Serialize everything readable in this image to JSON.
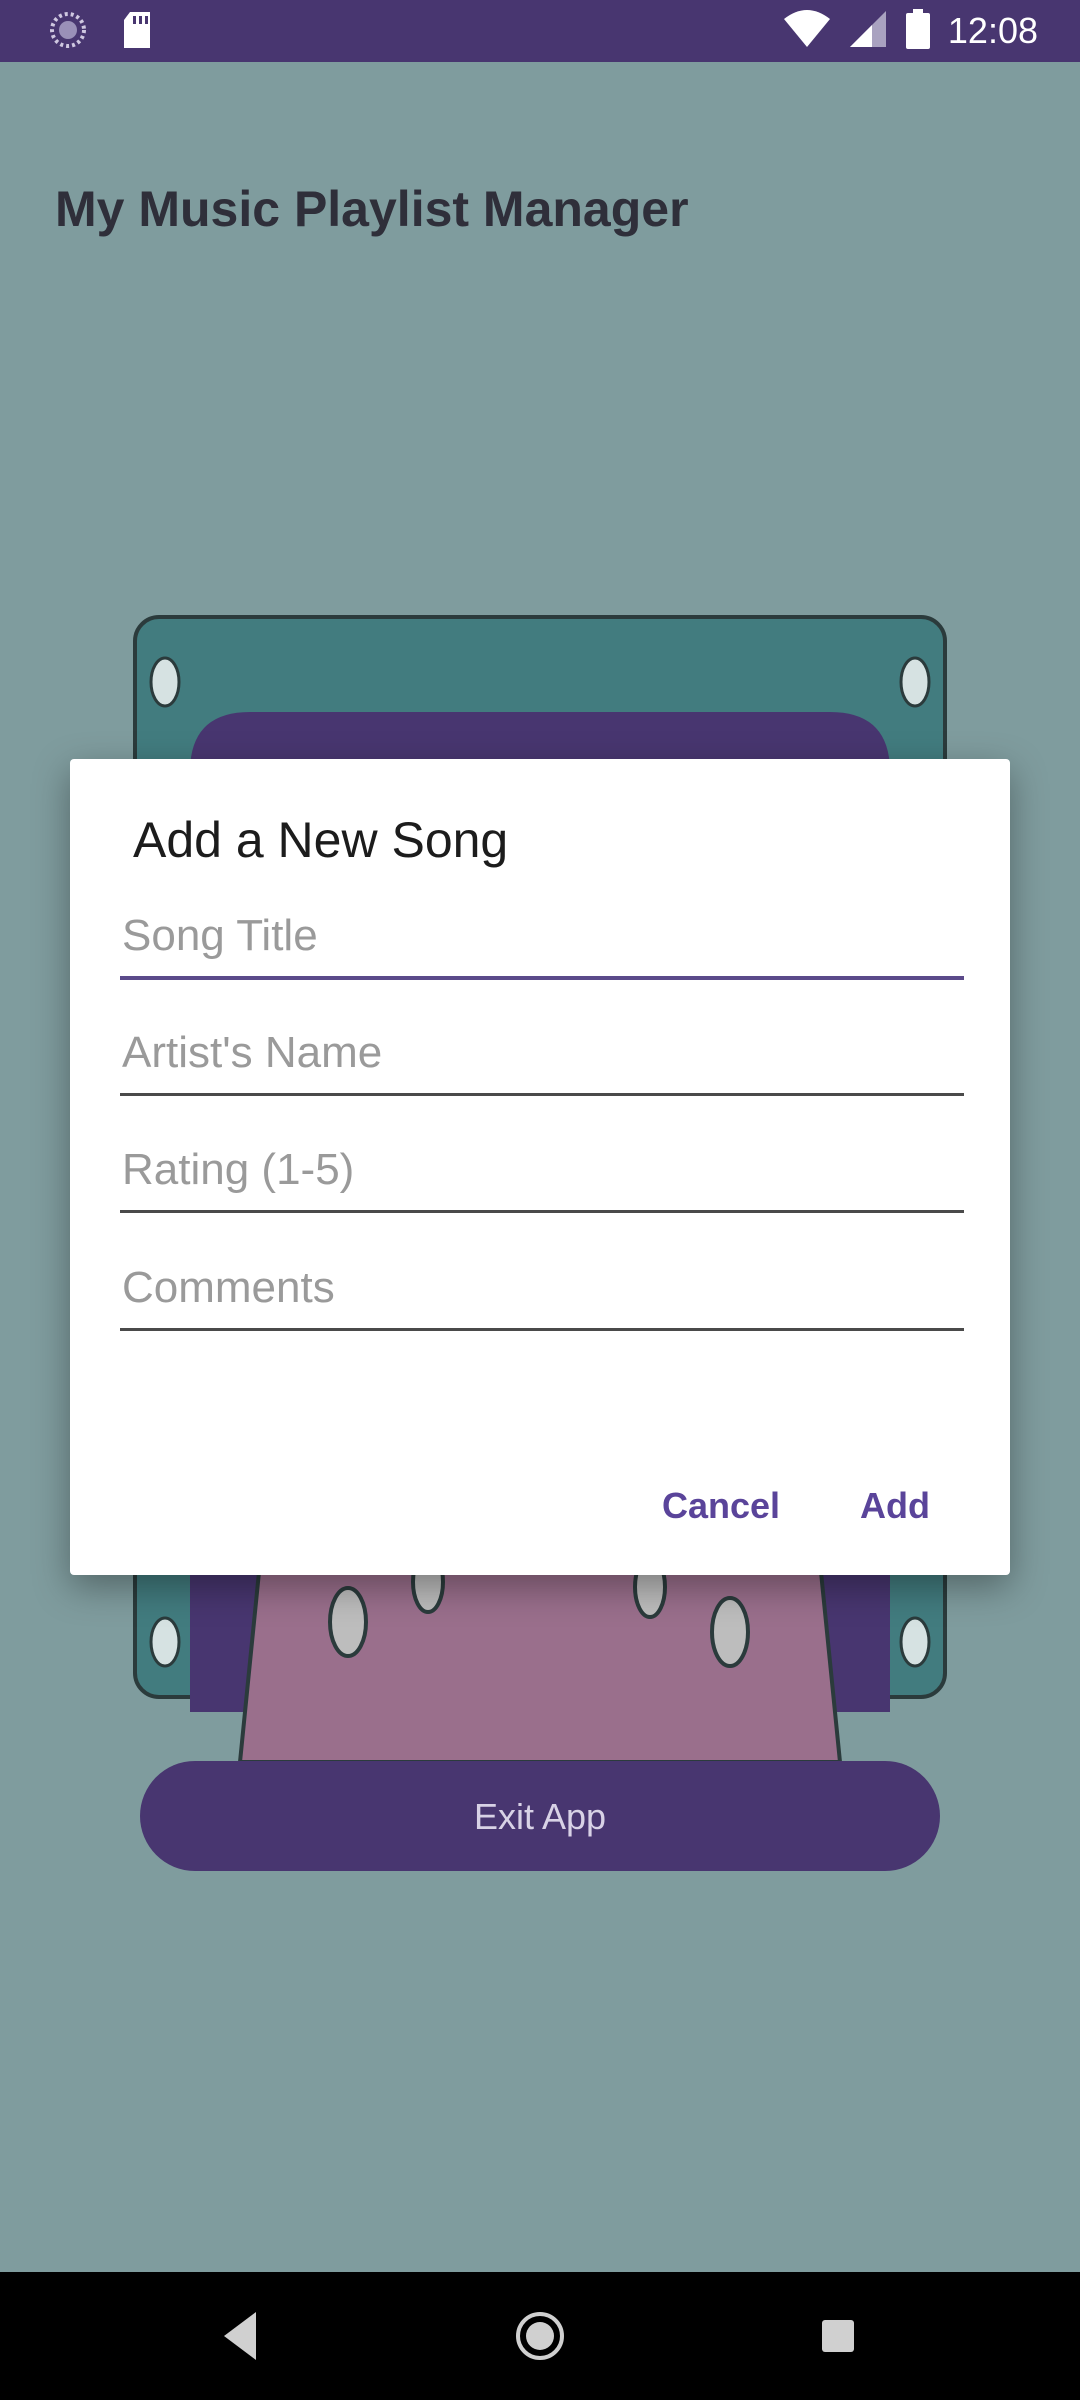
{
  "status_bar": {
    "time": "12:08",
    "icons_left": [
      "loading-icon",
      "sd-card-icon"
    ],
    "icons_right": [
      "wifi-icon",
      "signal-icon",
      "battery-icon"
    ]
  },
  "app": {
    "title": "My Music Playlist Manager",
    "exit_label": "Exit App",
    "colors": {
      "primary": "#483670",
      "background": "#7f9c9e"
    }
  },
  "dialog": {
    "title": "Add a New Song",
    "fields": {
      "song_title": {
        "placeholder": "Song Title",
        "value": ""
      },
      "artist_name": {
        "placeholder": "Artist's Name",
        "value": ""
      },
      "rating": {
        "placeholder": "Rating (1-5)",
        "value": ""
      },
      "comments": {
        "placeholder": "Comments",
        "value": ""
      }
    },
    "cancel_label": "Cancel",
    "add_label": "Add",
    "accent_color": "#5a449a"
  },
  "nav_bar": {
    "icons": [
      "back-icon",
      "home-icon",
      "recents-icon"
    ]
  }
}
